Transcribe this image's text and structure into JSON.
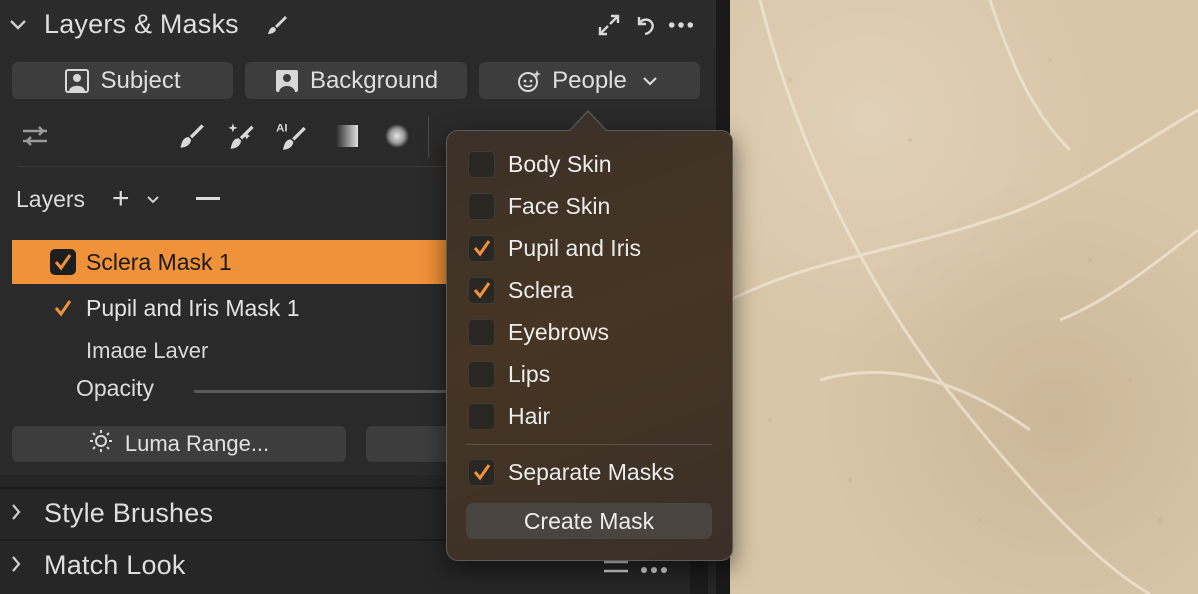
{
  "panel": {
    "title": "Layers & Masks",
    "header_icons": [
      "brush-icon",
      "expand-icon",
      "reset-icon",
      "more-icon"
    ]
  },
  "mask_buttons": {
    "subject": "Subject",
    "background": "Background",
    "people": "People"
  },
  "layers": {
    "label": "Layers",
    "items": [
      {
        "label": "Sclera Mask 1",
        "checked": true,
        "selected": true
      },
      {
        "label": "Pupil and Iris Mask 1",
        "checked": true,
        "selected": false
      }
    ],
    "sub_item": "Image Layer",
    "opacity_label": "Opacity"
  },
  "adjust_buttons": {
    "luma_range": "Luma Range..."
  },
  "sections": {
    "style_brushes": "Style Brushes",
    "match_look": "Match Look"
  },
  "people_menu": {
    "options": [
      {
        "label": "Body Skin",
        "checked": false
      },
      {
        "label": "Face Skin",
        "checked": false
      },
      {
        "label": "Pupil and Iris",
        "checked": true
      },
      {
        "label": "Sclera",
        "checked": true
      },
      {
        "label": "Eyebrows",
        "checked": false
      },
      {
        "label": "Lips",
        "checked": false
      },
      {
        "label": "Hair",
        "checked": false
      }
    ],
    "separate_masks": {
      "label": "Separate Masks",
      "checked": true
    },
    "create_button": "Create Mask"
  },
  "colors": {
    "accent": "#f0923a",
    "panel_bg": "#262626"
  }
}
